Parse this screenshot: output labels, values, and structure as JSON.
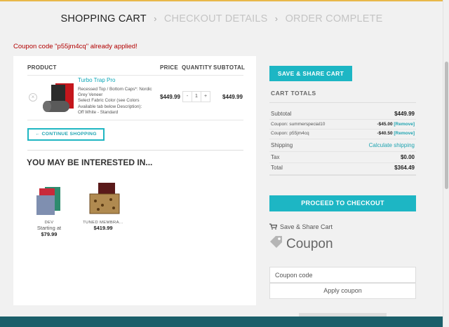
{
  "steps": {
    "cart": "SHOPPING CART",
    "details": "CHECKOUT DETAILS",
    "complete": "ORDER COMPLETE",
    "sep": "›"
  },
  "notice": "Coupon code \"p55jm4cq\" already applied!",
  "cart": {
    "headers": {
      "product": "PRODUCT",
      "price": "PRICE",
      "quantity": "QUANTITY",
      "subtotal": "SUBTOTAL"
    },
    "item": {
      "name": "Turbo Trap Pro",
      "desc1": "Recessed Top / Bottom Caps*: Nordic Grey Veneer",
      "desc2": "Select Fabric Color (see Colors Available tab below Description):",
      "desc3": "Off White - Standard",
      "price": "$449.99",
      "qty": "1",
      "minus": "-",
      "plus": "+",
      "subtotal": "$449.99",
      "remove": "×"
    },
    "continue": "← CONTINUE SHOPPING"
  },
  "interested": {
    "title": "YOU MAY BE INTERESTED IN...",
    "products": [
      {
        "category": "DEV",
        "label": "Starting at",
        "price": "$79.99"
      },
      {
        "category": "TUNED MEMBRA...",
        "label": "",
        "price": "$419.99"
      }
    ]
  },
  "sidebar": {
    "save_share_button": "SAVE & SHARE CART",
    "totals_title": "CART TOTALS",
    "subtotal_label": "Subtotal",
    "subtotal_value": "$449.99",
    "coupon1_label": "Coupon: summerspecial10",
    "coupon1_value": "-$45.00",
    "coupon2_label": "Coupon: p55jm4cq",
    "coupon2_value": "-$40.50",
    "remove_link": "[Remove]",
    "shipping_label": "Shipping",
    "shipping_link": "Calculate shipping",
    "tax_label": "Tax",
    "tax_value": "$0.00",
    "total_label": "Total",
    "total_value": "$364.49",
    "checkout_button": "PROCEED TO CHECKOUT",
    "save_share_link": "Save & Share Cart",
    "coupon_heading": "Coupon",
    "coupon_placeholder": "Coupon code",
    "apply_button": "Apply coupon"
  },
  "colors": {
    "accent": "#1db6c4",
    "error": "#b20000",
    "footer": "#1b5f6a"
  }
}
